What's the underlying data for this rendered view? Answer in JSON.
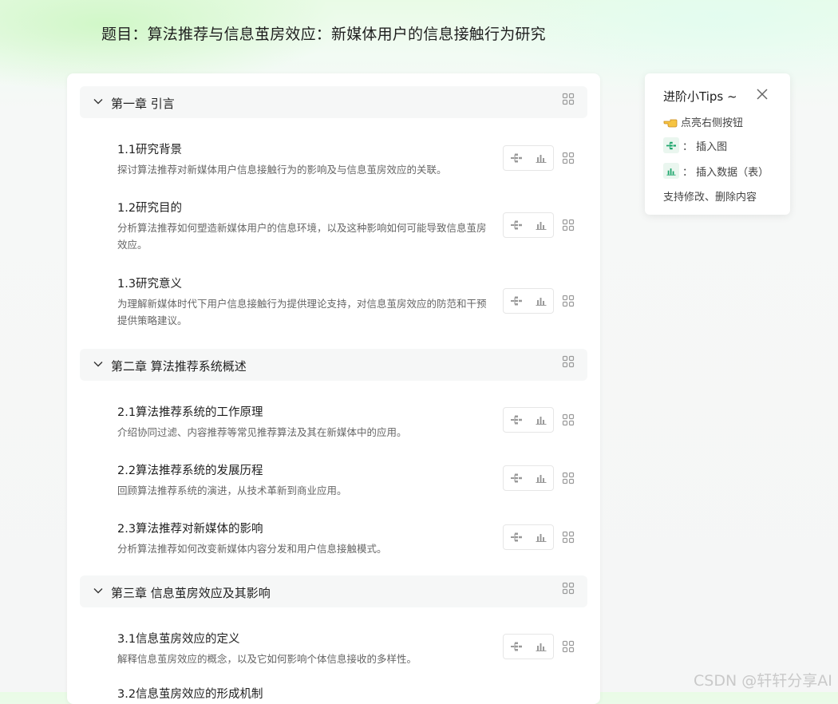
{
  "page": {
    "title": "题目：算法推荐与信息茧房效应：新媒体用户的信息接触行为研究"
  },
  "outline": {
    "chapters": [
      {
        "title": "第一章 引言",
        "sections": [
          {
            "title": "1.1研究背景",
            "desc": "探讨算法推荐对新媒体用户信息接触行为的影响及与信息茧房效应的关联。"
          },
          {
            "title": "1.2研究目的",
            "desc": "分析算法推荐如何塑造新媒体用户的信息环境，以及这种影响如何可能导致信息茧房效应。"
          },
          {
            "title": "1.3研究意义",
            "desc": "为理解新媒体时代下用户信息接触行为提供理论支持，对信息茧房效应的防范和干预提供策略建议。"
          }
        ]
      },
      {
        "title": "第二章 算法推荐系统概述",
        "sections": [
          {
            "title": "2.1算法推荐系统的工作原理",
            "desc": "介绍协同过滤、内容推荐等常见推荐算法及其在新媒体中的应用。"
          },
          {
            "title": "2.2算法推荐系统的发展历程",
            "desc": "回顾算法推荐系统的演进，从技术革新到商业应用。"
          },
          {
            "title": "2.3算法推荐对新媒体的影响",
            "desc": "分析算法推荐如何改变新媒体内容分发和用户信息接触模式。"
          }
        ]
      },
      {
        "title": "第三章 信息茧房效应及其影响",
        "sections": [
          {
            "title": "3.1信息茧房效应的定义",
            "desc": "解释信息茧房效应的概念，以及它如何影响个体信息接收的多样性。"
          },
          {
            "title": "3.2信息茧房效应的形成机制",
            "desc": ""
          }
        ]
      }
    ]
  },
  "tips": {
    "title": "进阶小Tips ~",
    "hint": "点亮右侧按钮",
    "insert_figure": "：  插入图",
    "insert_data": "：  插入数据（表）",
    "note": "支持修改、删除内容"
  },
  "watermark": "CSDN @轩轩分享AI",
  "colors": {
    "accent_green": "#1aa56a",
    "icon_gray": "#9a9a9a"
  }
}
